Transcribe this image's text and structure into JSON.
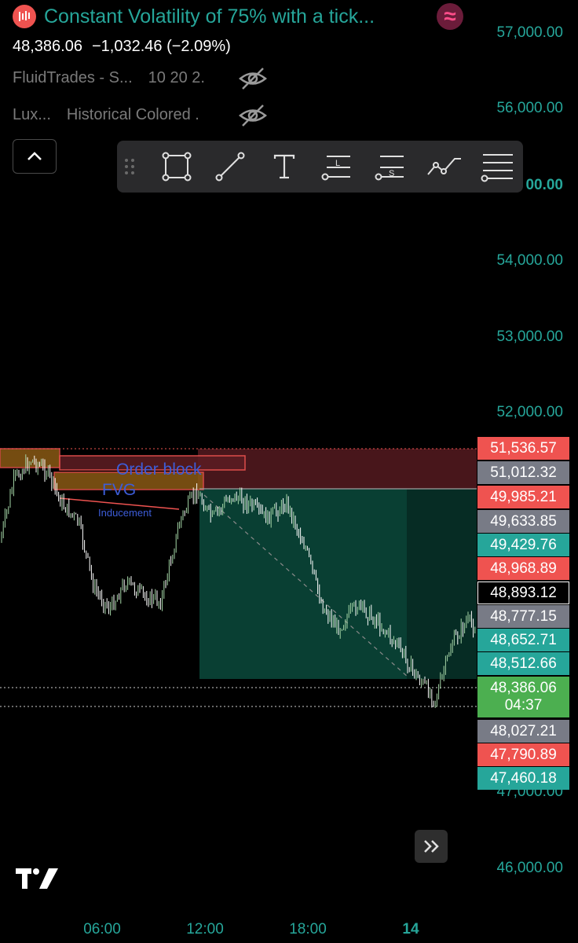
{
  "header": {
    "title": "Constant Volatility of 75% with a tick...",
    "price": "48,386.06",
    "change": "−1,032.46 (−2.09%)",
    "indicators": [
      {
        "name": "FluidTrades - S...",
        "params": "10 20 2.",
        "icon": "eye-off-icon"
      },
      {
        "name": "Lux...",
        "params": "Historical Colored .",
        "icon": "eye-off-icon"
      }
    ]
  },
  "toolbar": {
    "tools": [
      "drag-handle-icon",
      "rectangle-tool-icon",
      "trend-line-tool-icon",
      "text-tool-icon",
      "long-position-tool-icon",
      "short-position-tool-icon",
      "path-tool-icon",
      "more-tools-icon"
    ]
  },
  "price_axis": {
    "labels": [
      "57,000.00",
      "56,000.00",
      "00.00",
      "54,000.00",
      "53,000.00",
      "52,000.00",
      "47,000.00",
      "46,000.00"
    ]
  },
  "price_tags": [
    {
      "value": "51,536.57",
      "color": "#ef5350"
    },
    {
      "value": "51,012.32",
      "color": "#787b86"
    },
    {
      "value": "49,985.21",
      "color": "#ef5350"
    },
    {
      "value": "49,633.85",
      "color": "#787b86"
    },
    {
      "value": "49,429.76",
      "color": "#26a69a"
    },
    {
      "value": "48,968.89",
      "color": "#ef5350"
    },
    {
      "value": "48,893.12",
      "color": "#000000"
    },
    {
      "value": "48,777.15",
      "color": "#787b86"
    },
    {
      "value": "48,652.71",
      "color": "#26a69a"
    },
    {
      "value": "48,512.66",
      "color": "#26a69a"
    },
    {
      "value": "48,027.21",
      "color": "#787b86"
    },
    {
      "value": "47,790.89",
      "color": "#ef5350"
    },
    {
      "value": "47,460.18",
      "color": "#26a69a"
    }
  ],
  "current_price_tag": {
    "value": "48,386.06",
    "countdown": "04:37",
    "color": "#4caf50"
  },
  "time_axis": {
    "labels": [
      "06:00",
      "12:00",
      "18:00",
      "14"
    ]
  },
  "annotations": {
    "order_block": "Order block",
    "fvg": "FVG",
    "inducement": "Inducement"
  },
  "colors": {
    "up": "#26a69a",
    "down": "#ef5350",
    "accent": "#26a69a"
  }
}
